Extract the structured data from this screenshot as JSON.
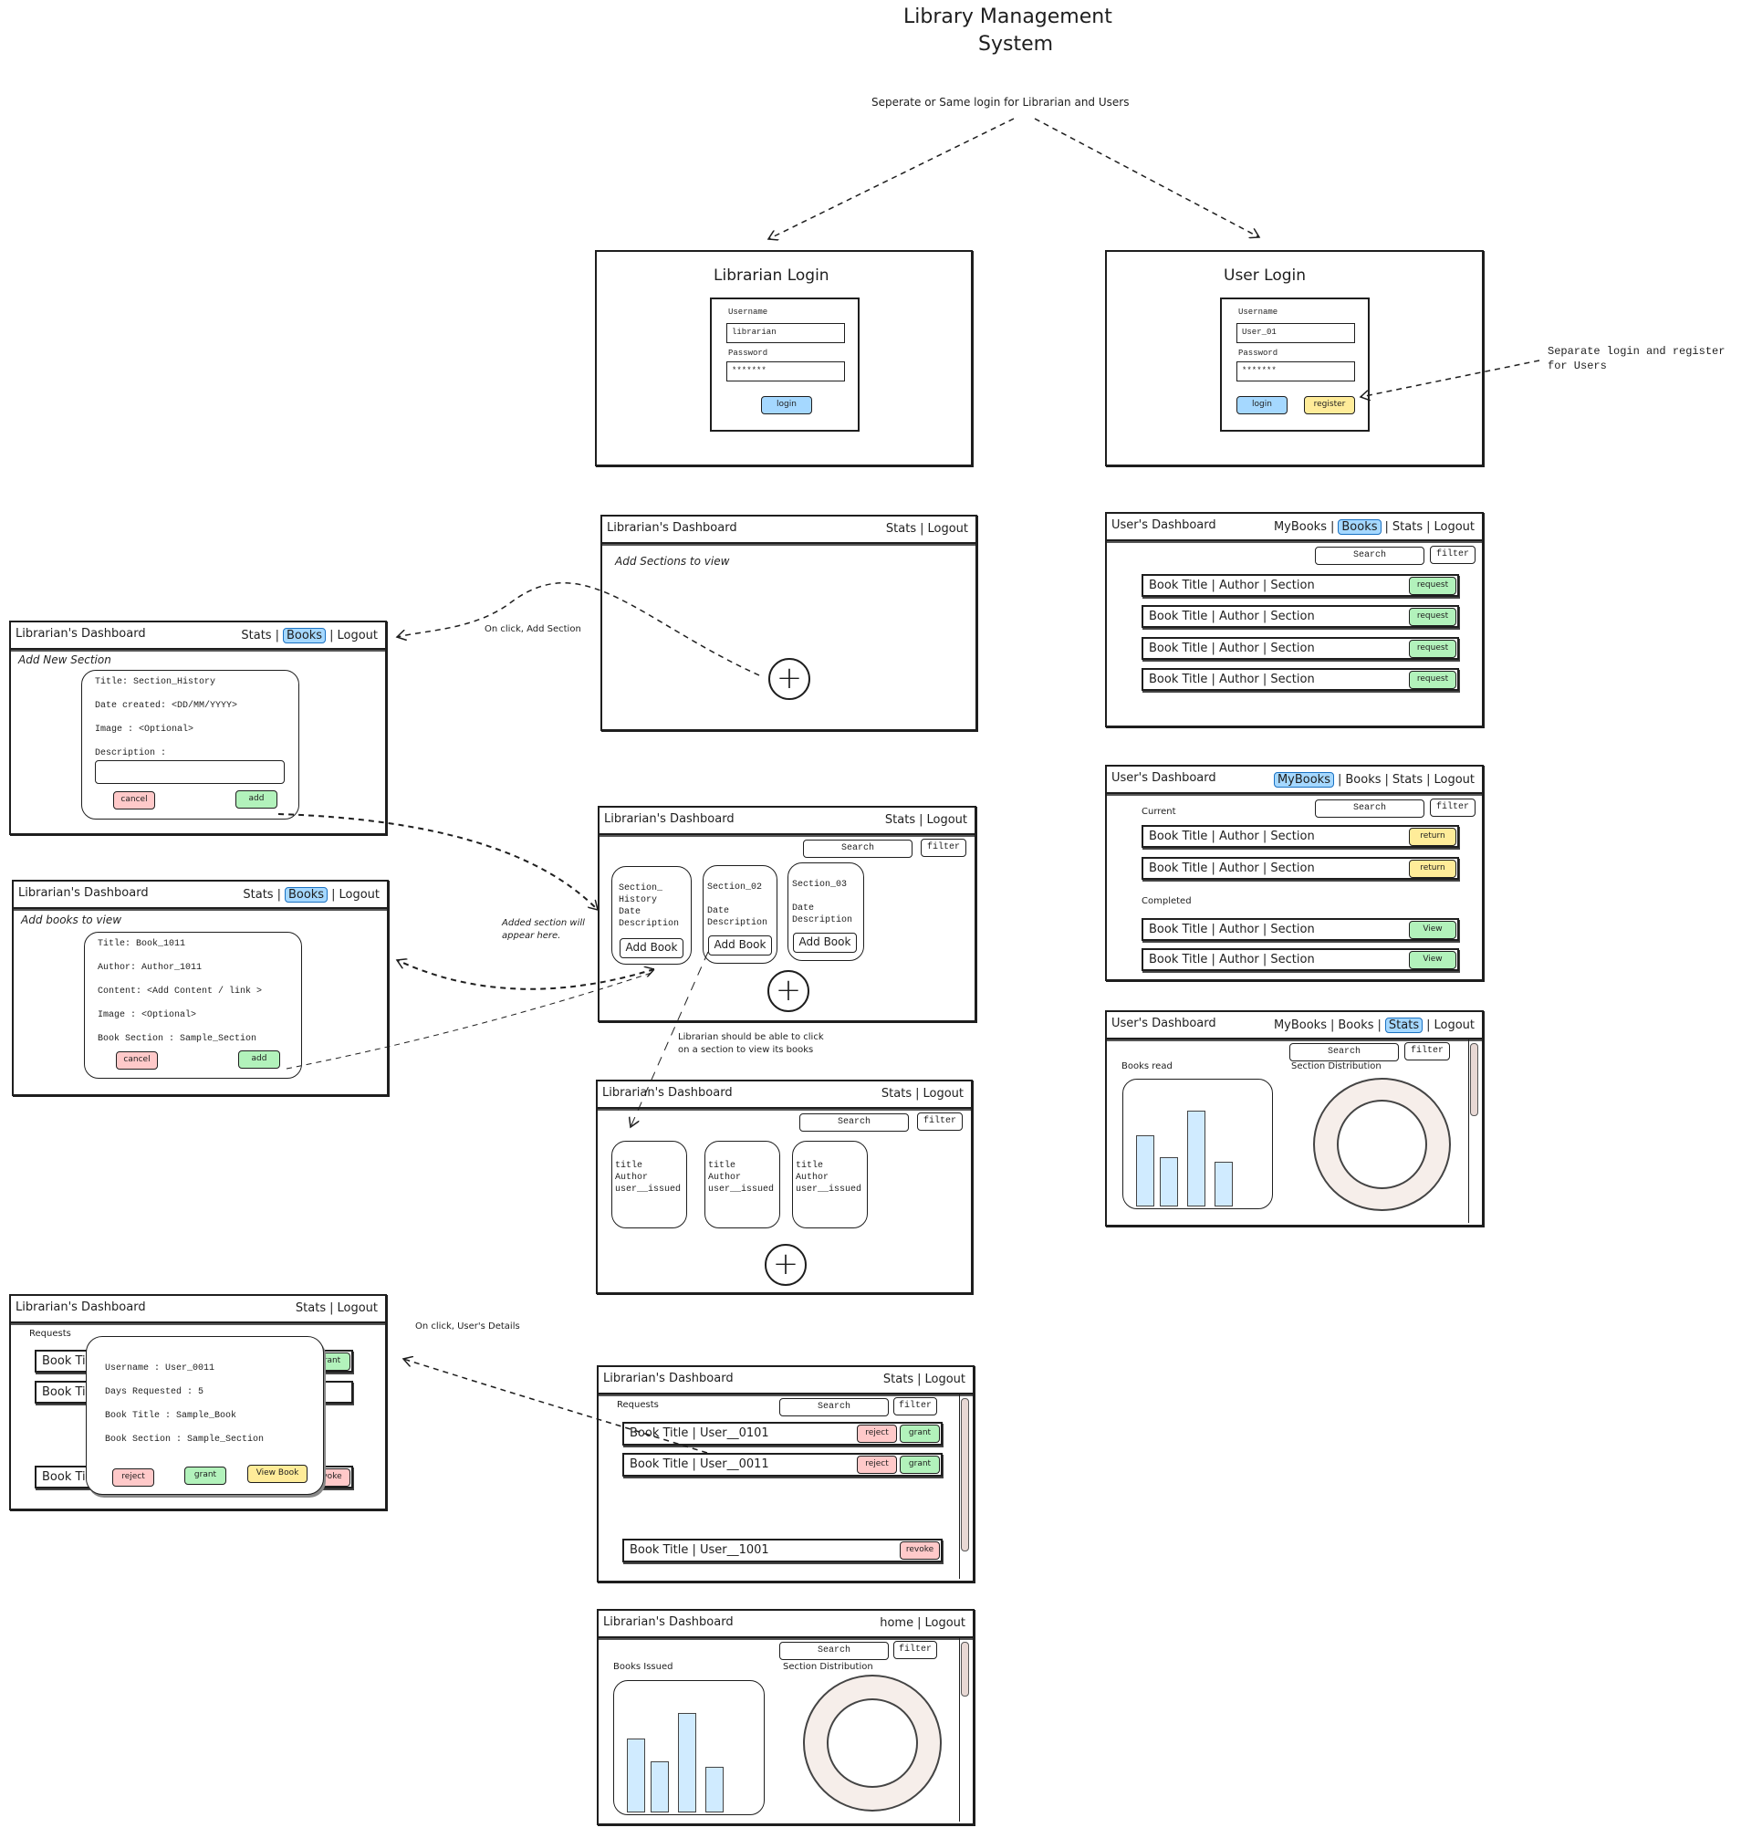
{
  "title": {
    "line1": "Library Management",
    "line2": "System"
  },
  "annotations": {
    "login_note": "Seperate or Same login for Librarian and Users",
    "register_note_1": "Separate login and register",
    "register_note_2": "for Users",
    "add_section_note": "On click, Add Section",
    "added_section_1": "Added section will",
    "added_section_2": "appear here.",
    "click_section_1": "Librarian should be able to click",
    "click_section_2": "on a section to view its books",
    "user_details_note": "On click, User's Details"
  },
  "librarian_login": {
    "title": "Librarian Login",
    "username_label": "Username",
    "username_value": "librarian",
    "password_label": "Password",
    "password_value": "*******",
    "login": "login"
  },
  "user_login": {
    "title": "User Login",
    "username_label": "Username",
    "username_value": "User_01",
    "password_label": "Password",
    "password_value": "*******",
    "login": "login",
    "register": "register"
  },
  "common": {
    "librarian_dashboard": "Librarian's Dashboard",
    "user_dashboard": "User's Dashboard",
    "stats": "Stats",
    "logout": "Logout",
    "books": "Books",
    "mybooks": "MyBooks",
    "home": "home",
    "search": "Search",
    "filter": "filter",
    "book_row": "Book Title | Author | Section",
    "request": "request",
    "return": "return",
    "view": "View",
    "cancel": "cancel",
    "add": "add",
    "add_book": "Add Book",
    "reject": "reject",
    "grant": "grant",
    "revoke": "revoke",
    "requests": "Requests",
    "plus": "+"
  },
  "empty_dashboard": {
    "message": "Add Sections to view"
  },
  "add_section": {
    "heading": "Add New Section",
    "title_line": "Title: Section_History",
    "date_line": "Date created: <DD/MM/YYYY>",
    "image_line": "Image : <Optional>",
    "description_label": "Description :"
  },
  "sections": [
    {
      "l1": "Section_",
      "l2": "History",
      "l3": "Date",
      "l4": "Description"
    },
    {
      "l1": "Section_02",
      "l2": "",
      "l3": "Date",
      "l4": "Description"
    },
    {
      "l1": "Section_03",
      "l2": "",
      "l3": "Date",
      "l4": "Description"
    }
  ],
  "add_book": {
    "heading": "Add books to view",
    "title_line": "Title: Book_1011",
    "author_line": "Author: Author_1011",
    "content_line": "Content: <Add Content / link >",
    "image_line": "Image : <Optional>",
    "section_line": "Book Section : Sample_Section"
  },
  "section_books": [
    {
      "l1": "title",
      "l2": "Author",
      "l3": "user__issued"
    },
    {
      "l1": "title",
      "l2": "Author",
      "l3": "user__issued"
    },
    {
      "l1": "title",
      "l2": "Author",
      "l3": "user__issued"
    }
  ],
  "my_books": {
    "current": "Current",
    "completed": "Completed"
  },
  "user_stats": {
    "books_read": "Books read",
    "section_distribution": "Section Distribution",
    "bars": [
      0.58,
      0.4,
      0.78,
      0.36
    ]
  },
  "requests_list": {
    "rows": [
      "Book Title | User__0101",
      "Book Title | User__0011",
      "Book Title | User__1001"
    ],
    "partial_row": "Book Ti",
    "partial_grant": "rant",
    "partial_revoke": "voke"
  },
  "user_details": {
    "username": "Username : User_0011",
    "days": "Days Requested : 5",
    "book_title": "Book Title : Sample_Book",
    "book_section": "Book Section : Sample_Section",
    "view_book": "View Book"
  },
  "librarian_stats": {
    "books_issued": "Books Issued",
    "section_distribution": "Section Distribution",
    "bars": [
      0.58,
      0.4,
      0.78,
      0.36
    ]
  },
  "colors": {
    "highlight": "#a5d8ff",
    "reject": "#ffc9c9",
    "grant": "#b2f2bb",
    "return": "#ffec99",
    "donut": "#f6eeea"
  }
}
